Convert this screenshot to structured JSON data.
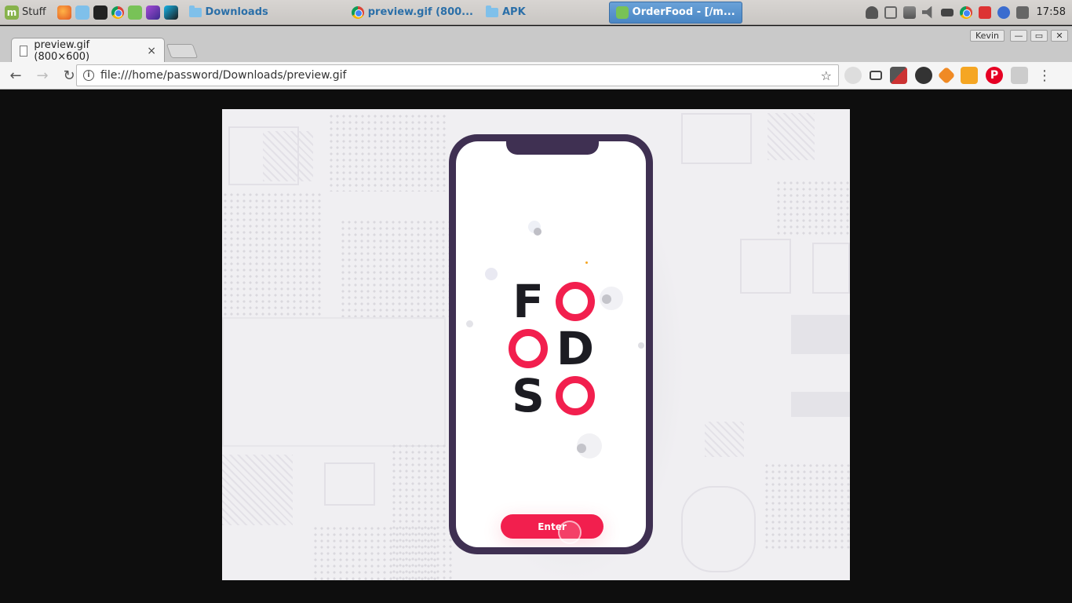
{
  "panel": {
    "menu_label": "Stuff",
    "tasks": [
      {
        "label": "Downloads"
      },
      {
        "label": "preview.gif (800..."
      },
      {
        "label": "APK"
      },
      {
        "label": "OrderFood - [/m..."
      }
    ],
    "clock": "17:58"
  },
  "browser": {
    "tab_title": "preview.gif (800×600)",
    "close_glyph": "×",
    "window_user": "Kevin",
    "url": "file:///home/password/Downloads/preview.gif",
    "back_glyph": "←",
    "forward_glyph": "→",
    "reload_glyph": "↻",
    "info_glyph": "i",
    "star_glyph": "☆",
    "menu_glyph": "⋮"
  },
  "app": {
    "logo_letters": [
      "F",
      "O",
      "O",
      "D",
      "S",
      "O"
    ],
    "enter_label": "Enter"
  },
  "colors": {
    "accent": "#f21f4e",
    "phone_frame": "#3f3052",
    "letter_dark": "#1c1c22"
  }
}
